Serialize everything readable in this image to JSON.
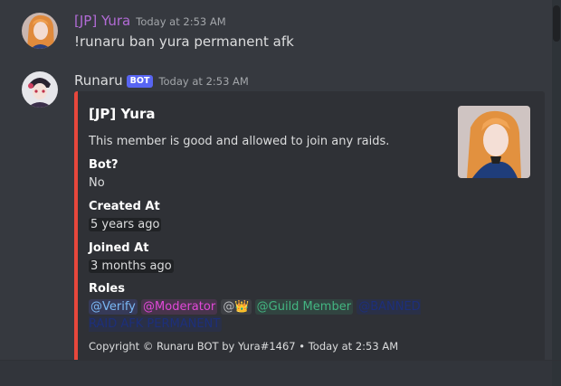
{
  "messages": [
    {
      "author": "[JP] Yura",
      "author_color": "#b26bd6",
      "timestamp": "Today at 2:53 AM",
      "content": "!runaru ban yura permanent afk"
    },
    {
      "author": "Runaru",
      "author_color": "#dcddde",
      "badge": "BOT",
      "timestamp": "Today at 2:53 AM"
    }
  ],
  "embed": {
    "accent_color": "#e8473c",
    "title": "[JP] Yura",
    "description": "This member is good and allowed to join any raids.",
    "fields": [
      {
        "name": "Bot?",
        "value": "No"
      },
      {
        "name": "Created At",
        "value": "5 years ago"
      },
      {
        "name": "Joined At",
        "value": "3 months ago"
      },
      {
        "name": "Roles"
      }
    ],
    "roles": [
      {
        "label": "@Verify",
        "color": "#7ab8f5"
      },
      {
        "label": "@Moderator",
        "color": "#e148d8"
      },
      {
        "label": "@",
        "emoji": "👑",
        "color": "#b9bbbe"
      },
      {
        "label": "@Guild Member",
        "color": "#43b581"
      },
      {
        "label": "@BANNED RAID AFK PERMANENT",
        "color": "#1d2f7a"
      }
    ],
    "footer": "Copyright © Runaru BOT by Yura#1467 • Today at 2:53 AM"
  }
}
